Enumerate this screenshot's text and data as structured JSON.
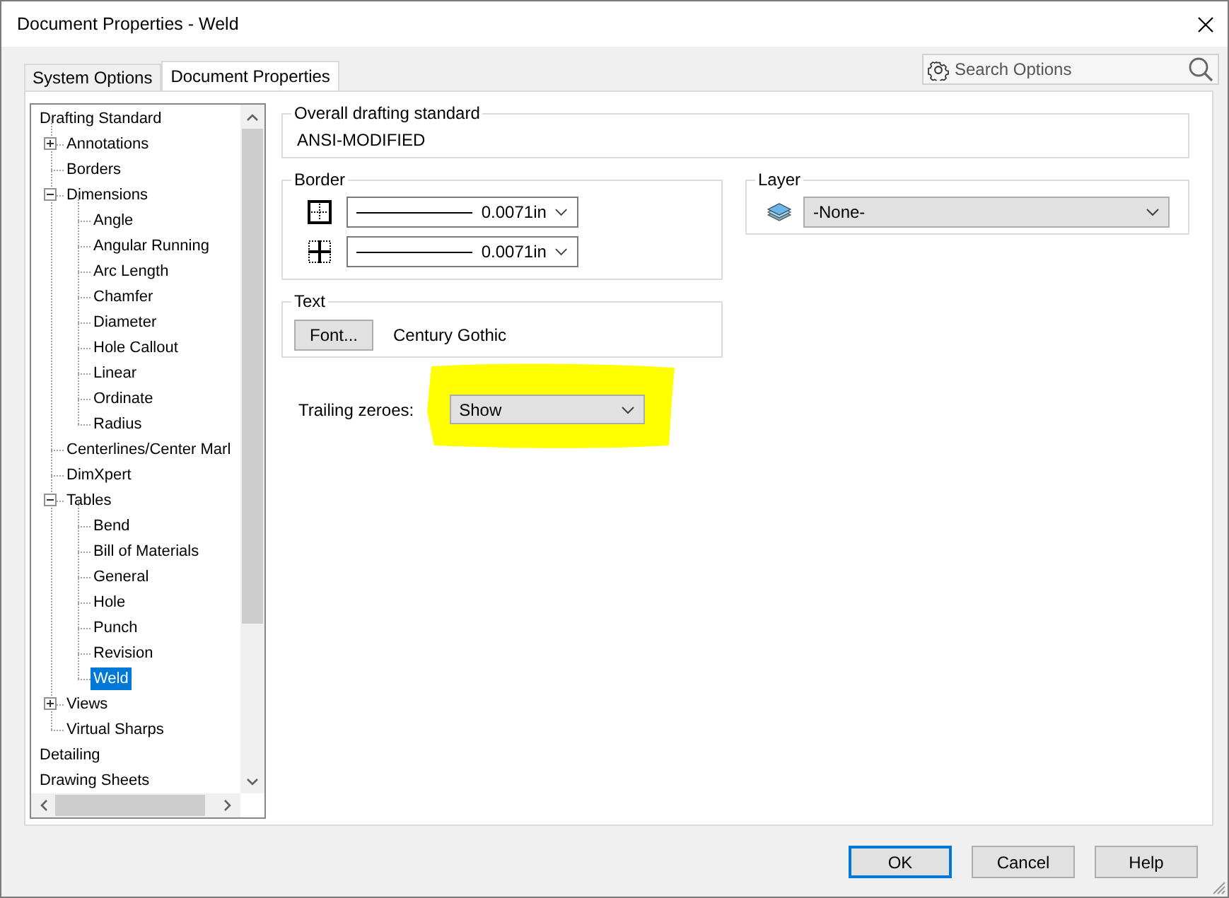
{
  "window": {
    "title": "Document Properties - Weld"
  },
  "tabs": [
    {
      "label": "System Options",
      "selected": false
    },
    {
      "label": "Document Properties",
      "selected": true
    }
  ],
  "search": {
    "placeholder": "Search Options"
  },
  "tree": {
    "items": [
      {
        "label": "Drafting Standard",
        "selected": false,
        "children": [
          {
            "label": "Annotations",
            "selected": false,
            "expanded": false
          },
          {
            "label": "Borders",
            "selected": false
          },
          {
            "label": "Dimensions",
            "selected": false,
            "expanded": true,
            "children": [
              {
                "label": "Angle",
                "selected": false
              },
              {
                "label": "Angular Running",
                "selected": false
              },
              {
                "label": "Arc Length",
                "selected": false
              },
              {
                "label": "Chamfer",
                "selected": false
              },
              {
                "label": "Diameter",
                "selected": false
              },
              {
                "label": "Hole Callout",
                "selected": false
              },
              {
                "label": "Linear",
                "selected": false
              },
              {
                "label": "Ordinate",
                "selected": false
              },
              {
                "label": "Radius",
                "selected": false
              }
            ]
          },
          {
            "label": "Centerlines/Center Marl",
            "selected": false
          },
          {
            "label": "DimXpert",
            "selected": false
          },
          {
            "label": "Tables",
            "selected": false,
            "expanded": true,
            "children": [
              {
                "label": "Bend",
                "selected": false
              },
              {
                "label": "Bill of Materials",
                "selected": false
              },
              {
                "label": "General",
                "selected": false
              },
              {
                "label": "Hole",
                "selected": false
              },
              {
                "label": "Punch",
                "selected": false
              },
              {
                "label": "Revision",
                "selected": false
              },
              {
                "label": "Weld",
                "selected": true
              }
            ]
          },
          {
            "label": "Views",
            "selected": false,
            "expanded": false
          },
          {
            "label": "Virtual Sharps",
            "selected": false
          }
        ]
      },
      {
        "label": "Detailing",
        "selected": false
      },
      {
        "label": "Drawing Sheets",
        "selected": false
      }
    ]
  },
  "overall_standard": {
    "label": "Overall drafting standard",
    "value": "ANSI-MODIFIED"
  },
  "border": {
    "label": "Border",
    "rows": [
      {
        "kind": "outer",
        "value": "0.0071in"
      },
      {
        "kind": "inner",
        "value": "0.0071in"
      }
    ]
  },
  "text": {
    "label": "Text",
    "button": "Font...",
    "font": "Century Gothic"
  },
  "layer": {
    "label": "Layer",
    "value": "-None-"
  },
  "trailing_zeroes": {
    "label": "Trailing zeroes:",
    "value": "Show"
  },
  "buttons": [
    {
      "label": "OK",
      "default": true
    },
    {
      "label": "Cancel",
      "default": false
    },
    {
      "label": "Help",
      "default": false
    }
  ]
}
